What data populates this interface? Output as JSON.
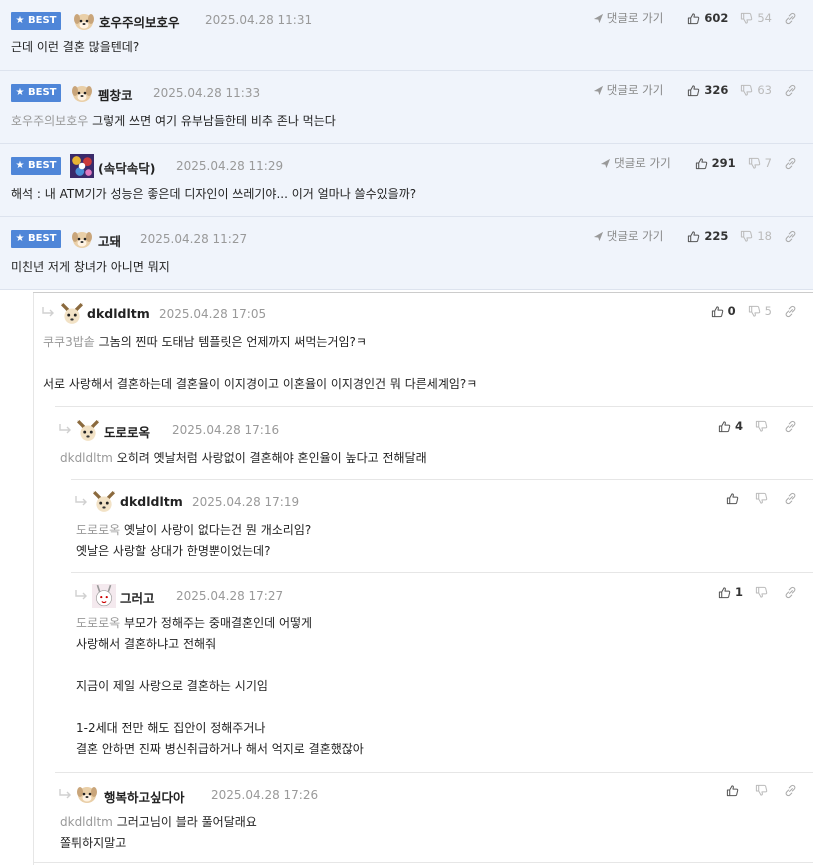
{
  "labels": {
    "best": "BEST",
    "reply_link": "댓글로 가기"
  },
  "best_comments": [
    {
      "nickname": "호우주의보호우",
      "date": "2025.04.28 11:31",
      "mention": "",
      "text": "근데 이런 결혼 많을텐데?",
      "up": "602",
      "down": "54"
    },
    {
      "nickname": "펨창코",
      "date": "2025.04.28 11:33",
      "mention": "호우주의보호우",
      "text": "그렇게 쓰면 여기 유부남들한테 비추 존나 먹는다",
      "up": "326",
      "down": "63"
    },
    {
      "nickname": "(속닥속닥)",
      "date": "2025.04.28 11:29",
      "mention": "",
      "text": "해석 : 내 ATM기가 성능은 좋은데 디자인이 쓰레기야... 이거 얼마나 쓸수있을까?",
      "up": "291",
      "down": "7"
    },
    {
      "nickname": "고돼",
      "date": "2025.04.28 11:27",
      "mention": "",
      "text": "미친년 저게 창녀가 아니면 뭐지",
      "up": "225",
      "down": "18"
    }
  ],
  "replies": [
    {
      "nickname": "dkdldltm",
      "date": "2025.04.28 17:05",
      "mention": "쿠쿠3밥솥",
      "text": "그놈의 찐따 도태남 템플릿은 언제까지 써먹는거임?ㅋ\n\n서로 사랑해서 결혼하는데 결혼율이 이지경이고 이혼율이 이지경인건 뭐 다른세계임?ㅋ",
      "up": "0",
      "down": "5"
    },
    {
      "nickname": "도로로옥",
      "date": "2025.04.28 17:16",
      "mention": "dkdldltm",
      "text": "오히려 옛날처럼 사랑없이 결혼해야 혼인율이 높다고 전해달래",
      "up": "4",
      "down": ""
    },
    {
      "nickname": "dkdldltm",
      "date": "2025.04.28 17:19",
      "mention": "도로로옥",
      "text": "옛날이 사랑이 없다는건 뭔 개소리임?\n옛날은 사랑할 상대가 한명뿐이었는데?",
      "up": "",
      "down": ""
    },
    {
      "nickname": "그러고",
      "date": "2025.04.28 17:27",
      "mention": "도로로옥",
      "text": "부모가 정해주는 중매결혼인데 어떻게\n사랑해서 결혼하냐고 전해줘\n\n지금이 제일 사랑으로 결혼하는 시기임\n\n1-2세대 전만 해도 집안이 정해주거나\n결혼 안하면 진짜 병신취급하거나 해서 억지로 결혼했잖아",
      "up": "1",
      "down": ""
    },
    {
      "nickname": "행복하고싶다아",
      "date": "2025.04.28 17:26",
      "mention": "dkdldltm",
      "text": "그러고님이 블라 풀어달래요\n쫄튀하지말고",
      "up": "",
      "down": ""
    }
  ]
}
